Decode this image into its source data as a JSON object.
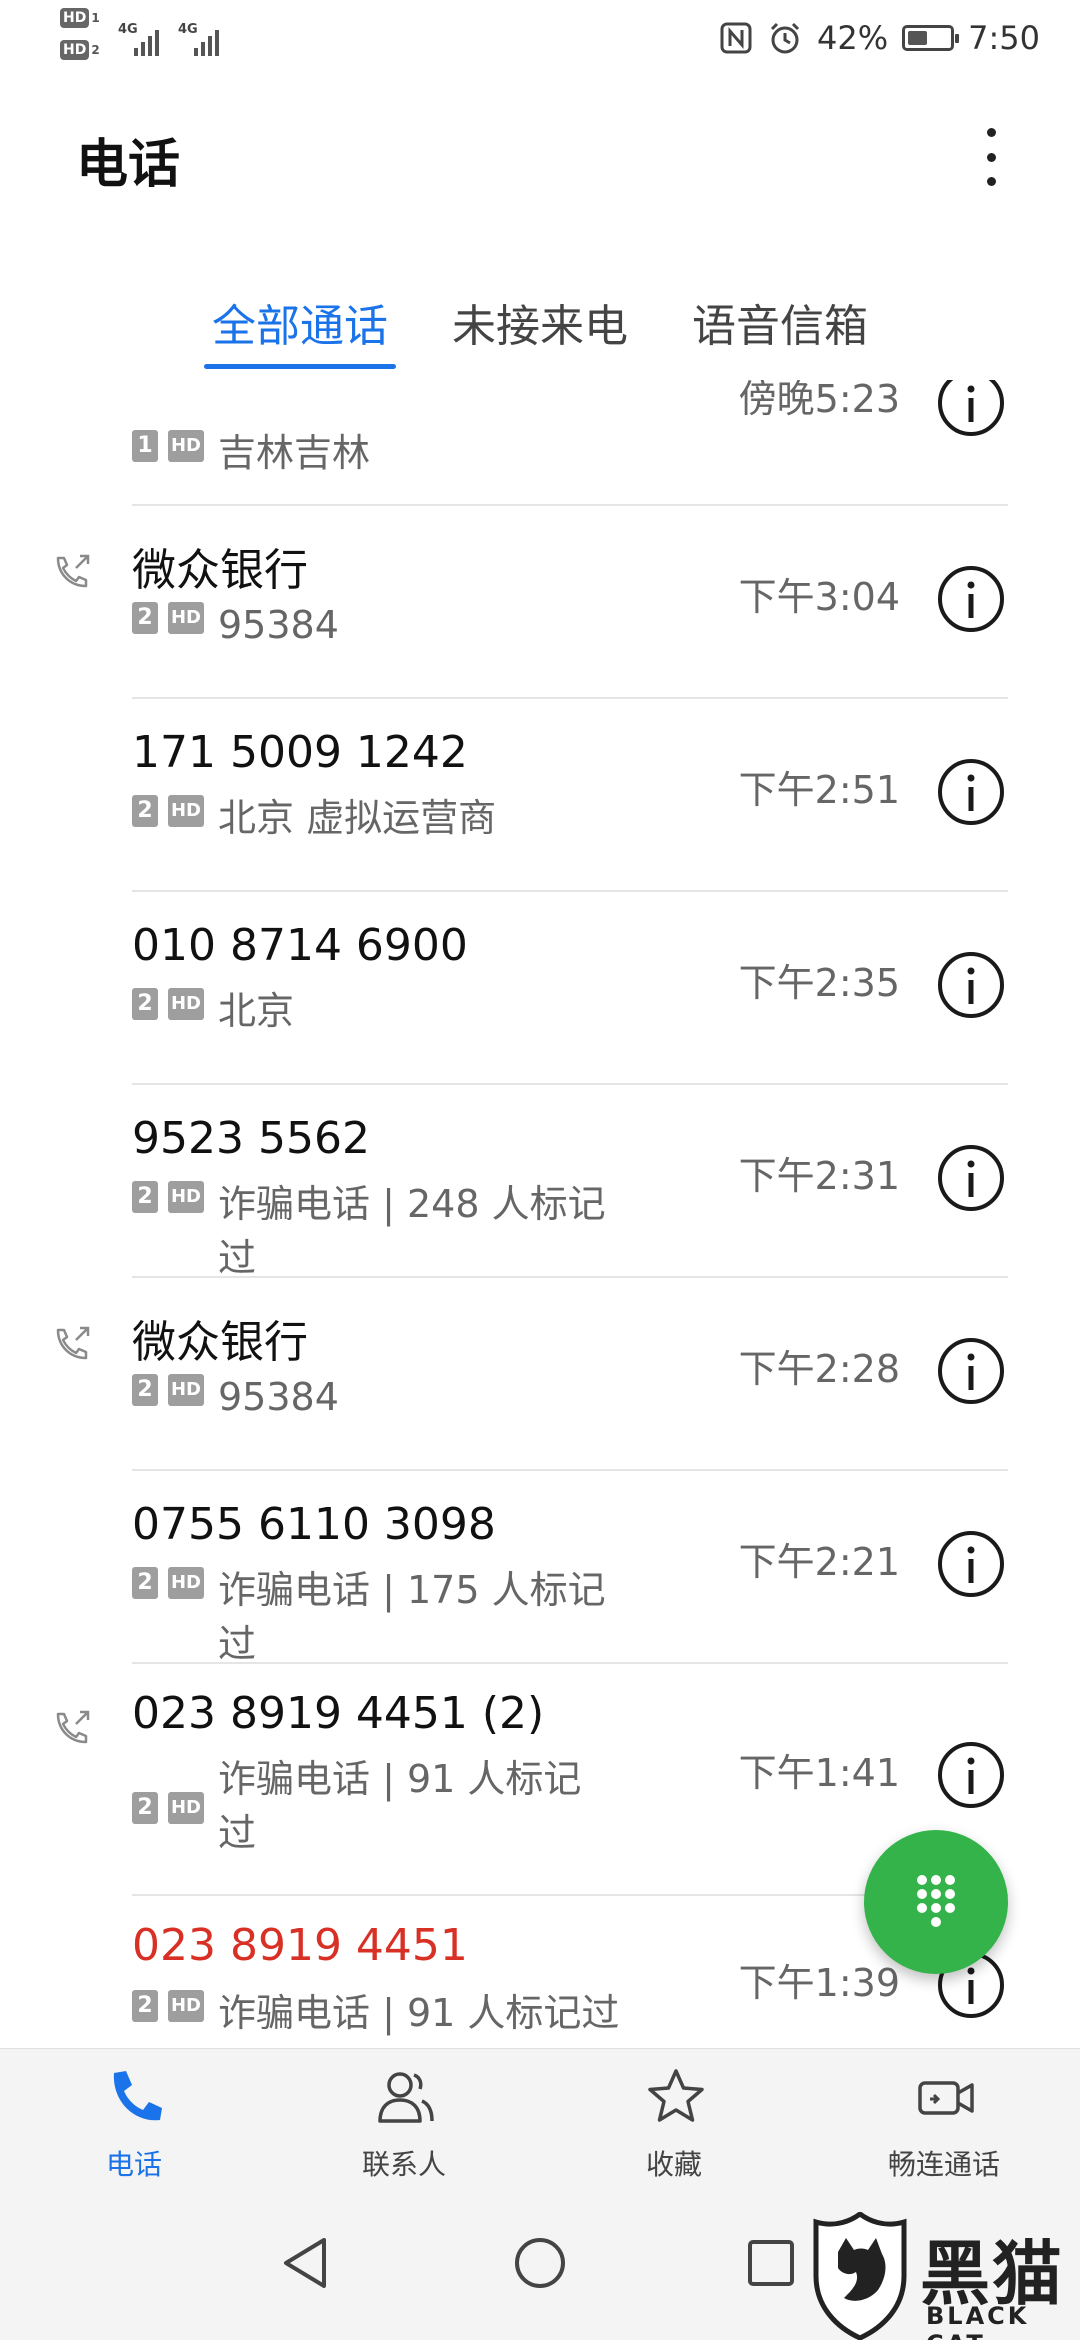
{
  "status_bar": {
    "sim1_hd": "HD",
    "sim1_num": "1",
    "sim2_hd": "HD",
    "sim2_num": "2",
    "sig1_label": "4G",
    "sig2_label": "4G",
    "battery": "42%",
    "time": "7:50"
  },
  "header": {
    "title": "电话"
  },
  "tabs": [
    {
      "label": "全部通话",
      "active": true
    },
    {
      "label": "未接来电",
      "active": false
    },
    {
      "label": "语音信箱",
      "active": false
    }
  ],
  "calls": [
    {
      "name": "",
      "sim": "1",
      "hd": "HD",
      "sub": "吉林吉林",
      "time": "傍晚5:23",
      "missed": false,
      "outgoing": false
    },
    {
      "name": "微众银行",
      "sim": "2",
      "hd": "HD",
      "sub": "95384",
      "time": "下午3:04",
      "missed": false,
      "outgoing": true
    },
    {
      "name": "171 5009 1242",
      "sim": "2",
      "hd": "HD",
      "sub": "北京 虚拟运营商",
      "time": "下午2:51",
      "missed": false,
      "outgoing": false
    },
    {
      "name": "010 8714 6900",
      "sim": "2",
      "hd": "HD",
      "sub": "北京",
      "time": "下午2:35",
      "missed": false,
      "outgoing": false
    },
    {
      "name": "9523 5562",
      "sim": "2",
      "hd": "HD",
      "sub": "诈骗电话 | 248 人标记过",
      "time": "下午2:31",
      "missed": false,
      "outgoing": false
    },
    {
      "name": "微众银行",
      "sim": "2",
      "hd": "HD",
      "sub": "95384",
      "time": "下午2:28",
      "missed": false,
      "outgoing": true
    },
    {
      "name": "0755 6110 3098",
      "sim": "2",
      "hd": "HD",
      "sub": "诈骗电话 | 175 人标记过",
      "time": "下午2:21",
      "missed": false,
      "outgoing": false
    },
    {
      "name": "023 8919 4451 (2)",
      "sim": "2",
      "hd": "HD",
      "sub": "诈骗电话 | 91 人标记过",
      "time": "下午1:41",
      "missed": false,
      "outgoing": true
    },
    {
      "name": "023 8919 4451",
      "sim": "2",
      "hd": "HD",
      "sub": "诈骗电话 | 91 人标记过",
      "time": "下午1:39",
      "missed": true,
      "outgoing": false
    }
  ],
  "bottom_nav": [
    {
      "label": "电话",
      "icon": "phone-icon",
      "active": true
    },
    {
      "label": "联系人",
      "icon": "contacts-icon",
      "active": false
    },
    {
      "label": "收藏",
      "icon": "star-icon",
      "active": false
    },
    {
      "label": "畅连通话",
      "icon": "video-call-icon",
      "active": false
    }
  ],
  "watermark": {
    "text": "黑猫",
    "sub": "BLACK CAT"
  },
  "colors": {
    "accent": "#1a73e8",
    "missed": "#d93025",
    "fab": "#34b34a"
  }
}
